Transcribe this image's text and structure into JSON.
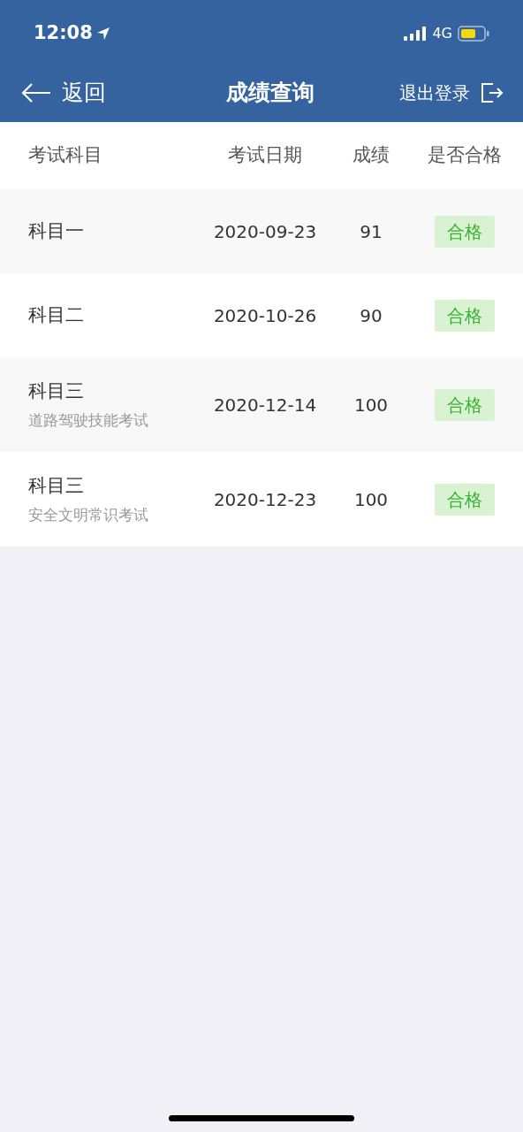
{
  "status_bar": {
    "time": "12:08",
    "network": "4G"
  },
  "nav": {
    "back_label": "返回",
    "title": "成绩查询",
    "logout_label": "退出登录"
  },
  "table": {
    "columns": [
      "考试科目",
      "考试日期",
      "成绩",
      "是否合格"
    ],
    "rows": [
      {
        "subject": "科目一",
        "date": "2020-09-23",
        "score": "91",
        "result": "合格",
        "passed": true
      },
      {
        "subject": "科目二",
        "date": "2020-10-26",
        "score": "90",
        "result": "合格",
        "passed": true
      },
      {
        "subject": "科目三",
        "detail": "道路驾驶技能考试",
        "date": "2020-12-14",
        "score": "100",
        "result": "合格",
        "passed": true
      },
      {
        "subject": "科目三",
        "detail": "安全文明常识考试",
        "date": "2020-12-23",
        "score": "100",
        "result": "合格",
        "passed": true
      }
    ]
  }
}
